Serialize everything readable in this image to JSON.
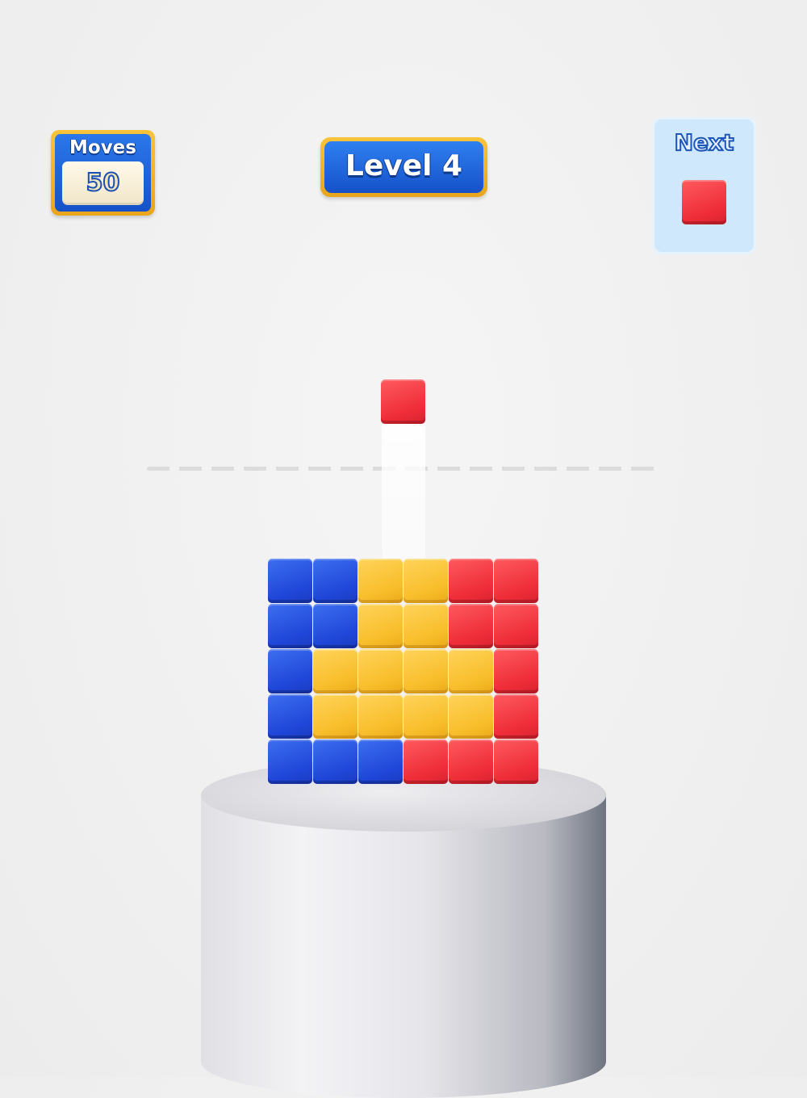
{
  "hud": {
    "moves_label": "Moves",
    "moves_value": "50",
    "level_label": "Level 4",
    "next_label": "Next",
    "next_block_color": "red"
  },
  "falling_block": {
    "color": "red"
  },
  "colors": {
    "blue": "#2a55e0",
    "yellow": "#f9c333",
    "red": "#f23a42"
  },
  "grid": {
    "rows": [
      [
        "blue",
        "blue",
        "yellow",
        "yellow",
        "red",
        "red"
      ],
      [
        "blue",
        "blue",
        "yellow",
        "yellow",
        "red",
        "red"
      ],
      [
        "blue",
        "yellow",
        "yellow",
        "yellow",
        "yellow",
        "red"
      ],
      [
        "blue",
        "yellow",
        "yellow",
        "yellow",
        "yellow",
        "red"
      ],
      [
        "blue",
        "blue",
        "blue",
        "red",
        "red",
        "red"
      ]
    ]
  }
}
